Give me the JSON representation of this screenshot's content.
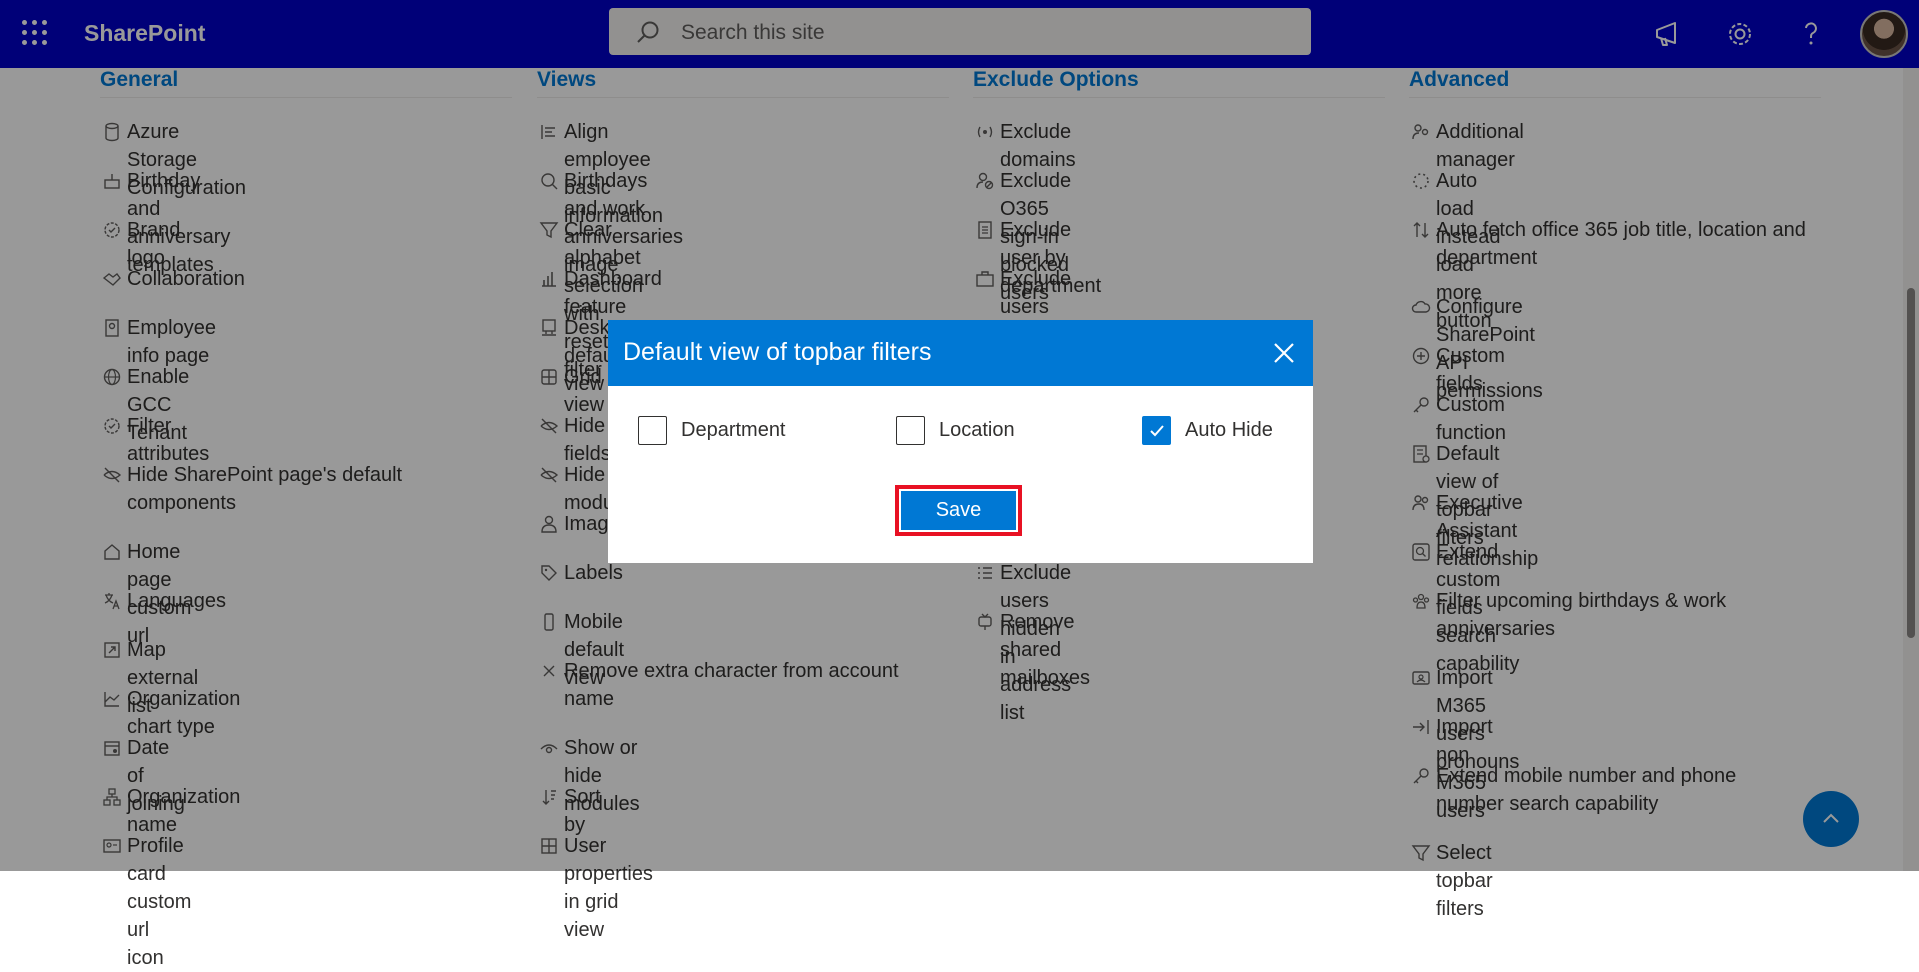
{
  "app": {
    "brand": "SharePoint"
  },
  "search": {
    "placeholder": "Search this site"
  },
  "colors": {
    "topbar": "#0000c8",
    "accent": "#0078d4",
    "highlight": "#e81123"
  },
  "columns": [
    {
      "heading": "General",
      "items": [
        {
          "label": "Azure Storage Configuration",
          "icon": "database-icon"
        },
        {
          "label": "Birthday and anniversary templates",
          "icon": "cake-icon"
        },
        {
          "label": "Brand logo",
          "icon": "badge-icon"
        },
        {
          "label": "Collaboration",
          "icon": "handshake-icon"
        },
        {
          "label": "Employee info page",
          "icon": "person-page-icon"
        },
        {
          "label": "Enable GCC Tenant",
          "icon": "globe-icon"
        },
        {
          "label": "Filter attributes",
          "icon": "badge-check-icon"
        },
        {
          "label": "Hide SharePoint page's default components",
          "icon": "eye-off-icon"
        },
        {
          "label": "Home page custom url",
          "icon": "home-icon"
        },
        {
          "label": "Languages",
          "icon": "translate-icon"
        },
        {
          "label": "Map external list",
          "icon": "map-list-icon"
        },
        {
          "label": "Organization chart type",
          "icon": "chart-icon"
        },
        {
          "label": "Date of joining",
          "icon": "calendar-icon"
        },
        {
          "label": "Organization name",
          "icon": "org-icon"
        },
        {
          "label": "Profile card custom url icon",
          "icon": "contact-card-icon"
        }
      ]
    },
    {
      "heading": "Views",
      "items": [
        {
          "label": "Align employee basic information",
          "icon": "align-icon"
        },
        {
          "label": "Birthdays and work anniversaries image",
          "icon": "image-search-icon"
        },
        {
          "label": "Clear alphabet selection with reset filter",
          "icon": "filter-icon"
        },
        {
          "label": "Dashboard feature",
          "icon": "bar-chart-icon"
        },
        {
          "label": "Desktop default view",
          "icon": "desktop-icon"
        },
        {
          "label": "Grid view",
          "icon": "grid-icon"
        },
        {
          "label": "Hide fields",
          "icon": "eye-off-icon"
        },
        {
          "label": "Hide modules",
          "icon": "eye-off-icon"
        },
        {
          "label": "Image",
          "icon": "person-icon"
        },
        {
          "label": "Labels",
          "icon": "tag-icon"
        },
        {
          "label": "Mobile default view",
          "icon": "mobile-icon"
        },
        {
          "label": "Remove extra character from account name",
          "icon": "x-icon"
        },
        {
          "label": "Show or hide modules",
          "icon": "eye-icon"
        },
        {
          "label": "Sort by",
          "icon": "sort-icon"
        },
        {
          "label": "User properties in grid view",
          "icon": "grid-plus-icon"
        }
      ]
    },
    {
      "heading": "Exclude Options",
      "items": [
        {
          "label": "Exclude domains",
          "icon": "broadcast-icon"
        },
        {
          "label": "Exclude O365 sign-in blocked users",
          "icon": "person-blocked-icon"
        },
        {
          "label": "Exclude user by department",
          "icon": "document-icon"
        },
        {
          "label": "Exclude users by job title",
          "icon": "briefcase-icon"
        },
        {
          "label": "Exclude users hidden in address list",
          "icon": "list-icon"
        },
        {
          "label": "Remove shared mailboxes",
          "icon": "mailbox-icon"
        }
      ]
    },
    {
      "heading": "Advanced",
      "items": [
        {
          "label": "Additional manager",
          "icon": "people-icon"
        },
        {
          "label": "Auto load instead load more button",
          "icon": "spinner-icon"
        },
        {
          "label": "Auto fetch office 365 job title, location and department",
          "icon": "arrows-icon"
        },
        {
          "label": "Configure SharePoint API permissions",
          "icon": "cloud-sync-icon"
        },
        {
          "label": "Custom fields",
          "icon": "add-circle-icon"
        },
        {
          "label": "Custom function",
          "icon": "key-icon"
        },
        {
          "label": "Default view of topbar filters",
          "icon": "list-settings-icon"
        },
        {
          "label": "Executive Assistant relationship",
          "icon": "people-icon"
        },
        {
          "label": "Extend custom fields search capability",
          "icon": "search-box-icon"
        },
        {
          "label": "Filter upcoming birthdays & work anniversaries",
          "icon": "people-group-icon"
        },
        {
          "label": "Import M365 users pronouns",
          "icon": "id-card-icon"
        },
        {
          "label": "Import non M365 users",
          "icon": "import-icon"
        },
        {
          "label": "Extend mobile number and phone number search capability",
          "icon": "key-icon"
        },
        {
          "label": "Select topbar filters",
          "icon": "filter-icon"
        }
      ]
    }
  ],
  "dialog": {
    "title": "Default view of topbar filters",
    "options": [
      {
        "label": "Department",
        "checked": false
      },
      {
        "label": "Location",
        "checked": false
      },
      {
        "label": "Auto Hide",
        "checked": true
      }
    ],
    "save_label": "Save"
  }
}
